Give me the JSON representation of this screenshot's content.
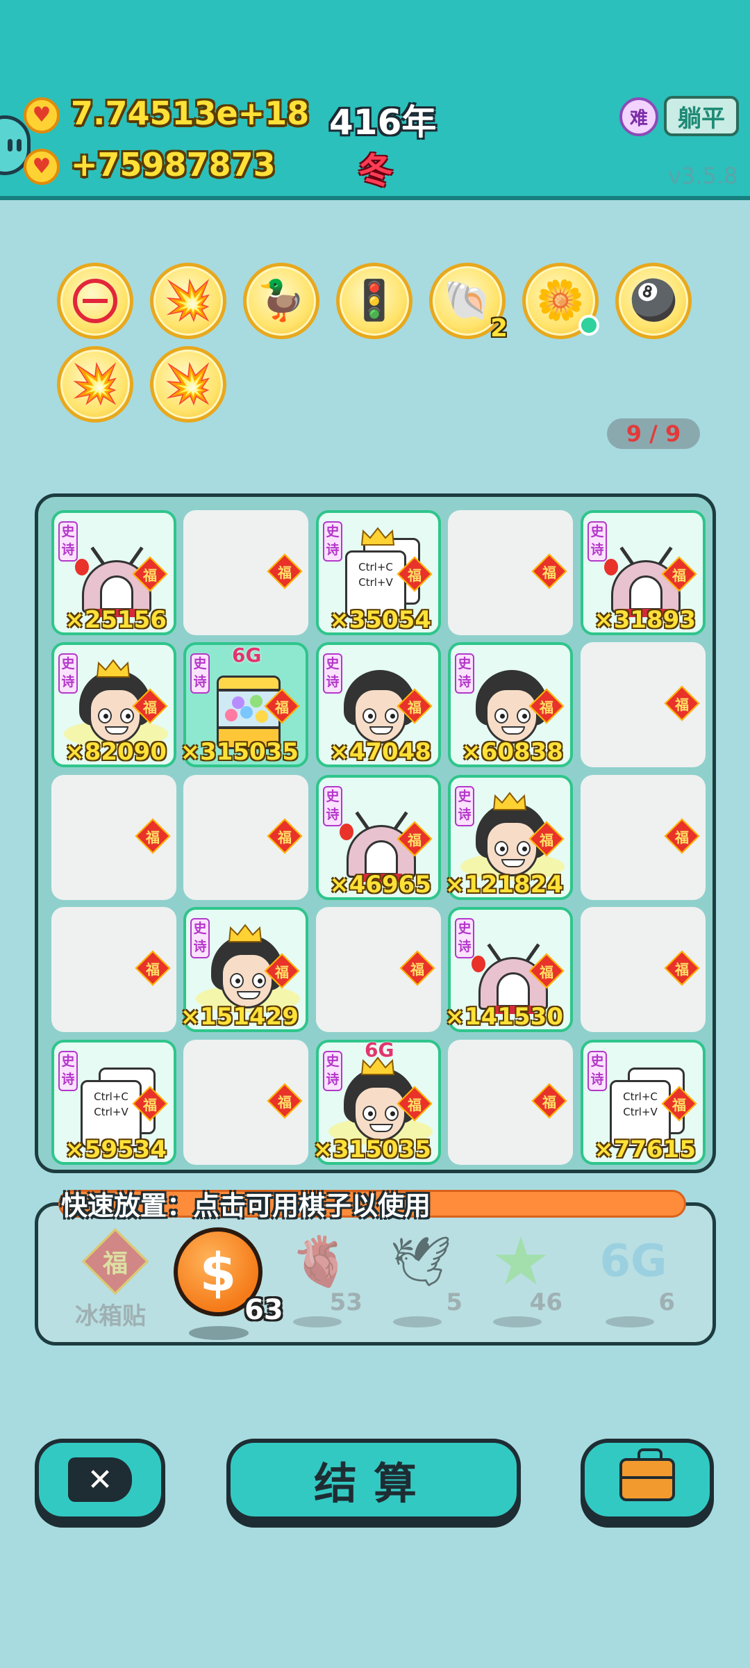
{
  "header": {
    "money_total": "7.74513e+18",
    "money_income": "+75987873",
    "year": "416年",
    "season": "冬",
    "difficulty": "难",
    "mode": "躺平",
    "version": "v3.5.8"
  },
  "items": [
    {
      "icon": "no-entry-icon",
      "glyph": "",
      "count": ""
    },
    {
      "icon": "mushroom-cloud-icon",
      "glyph": "💥",
      "count": ""
    },
    {
      "icon": "duck-pot-icon",
      "glyph": "🦆",
      "count": ""
    },
    {
      "icon": "traffic-light-ghost-icon",
      "glyph": "🚦",
      "count": ""
    },
    {
      "icon": "shell-icon",
      "glyph": "🐚",
      "count": "2"
    },
    {
      "icon": "flower-pot-icon",
      "glyph": "🌼",
      "count": ""
    },
    {
      "icon": "capsule-balls-icon",
      "glyph": "🎱",
      "count": ""
    },
    {
      "icon": "mushroom-cloud-icon",
      "glyph": "💥",
      "count": ""
    },
    {
      "icon": "mushroom-cloud-icon",
      "glyph": "💥",
      "count": ""
    }
  ],
  "capacity": "9 / 9",
  "board": {
    "tag": "史诗",
    "fu": "福",
    "copy_line1": "Ctrl+C",
    "copy_line2": "Ctrl+V",
    "cells": [
      {
        "type": "tent",
        "mult": "×25156"
      },
      {
        "type": "empty",
        "mult": ""
      },
      {
        "type": "copy-crown",
        "mult": "×35054"
      },
      {
        "type": "empty",
        "mult": ""
      },
      {
        "type": "tent",
        "mult": "×31893"
      },
      {
        "type": "face-crown",
        "mult": "×82090"
      },
      {
        "type": "claw-6g",
        "mult": "×315035"
      },
      {
        "type": "face",
        "mult": "×47048"
      },
      {
        "type": "face",
        "mult": "×60838"
      },
      {
        "type": "empty",
        "mult": ""
      },
      {
        "type": "empty",
        "mult": ""
      },
      {
        "type": "empty",
        "mult": ""
      },
      {
        "type": "tent",
        "mult": "×46965"
      },
      {
        "type": "face-crown",
        "mult": "×121824"
      },
      {
        "type": "empty",
        "mult": ""
      },
      {
        "type": "empty",
        "mult": ""
      },
      {
        "type": "face-crown",
        "mult": "×151429"
      },
      {
        "type": "empty",
        "mult": ""
      },
      {
        "type": "tent",
        "mult": "×141530"
      },
      {
        "type": "empty",
        "mult": ""
      },
      {
        "type": "copy",
        "mult": "×59534"
      },
      {
        "type": "empty",
        "mult": ""
      },
      {
        "type": "face-crown-6g",
        "mult": "×315035"
      },
      {
        "type": "empty",
        "mult": ""
      },
      {
        "type": "copy",
        "mult": "×77615"
      }
    ],
    "g6_label": "6G"
  },
  "quick_place": {
    "title": "快速放置：点击可用棋子以使用",
    "fridge_label": "冰箱贴",
    "fridge_glyph": "福",
    "coin_count": "63",
    "others": [
      {
        "icon": "liver-icon",
        "glyph": "🫀",
        "count": "53"
      },
      {
        "icon": "bird-icon",
        "glyph": "🕊",
        "count": "5"
      },
      {
        "icon": "star-icon",
        "glyph": "★",
        "count": "46"
      },
      {
        "icon": "6g-icon",
        "glyph": "6G",
        "count": "6"
      }
    ]
  },
  "buttons": {
    "close": "✕",
    "settle": "结算"
  },
  "colors": {
    "background": "#a7dbe0",
    "topbar": "#2bc0bb",
    "accent_orange": "#ff8c3a",
    "cell_border": "#2fc58b"
  }
}
